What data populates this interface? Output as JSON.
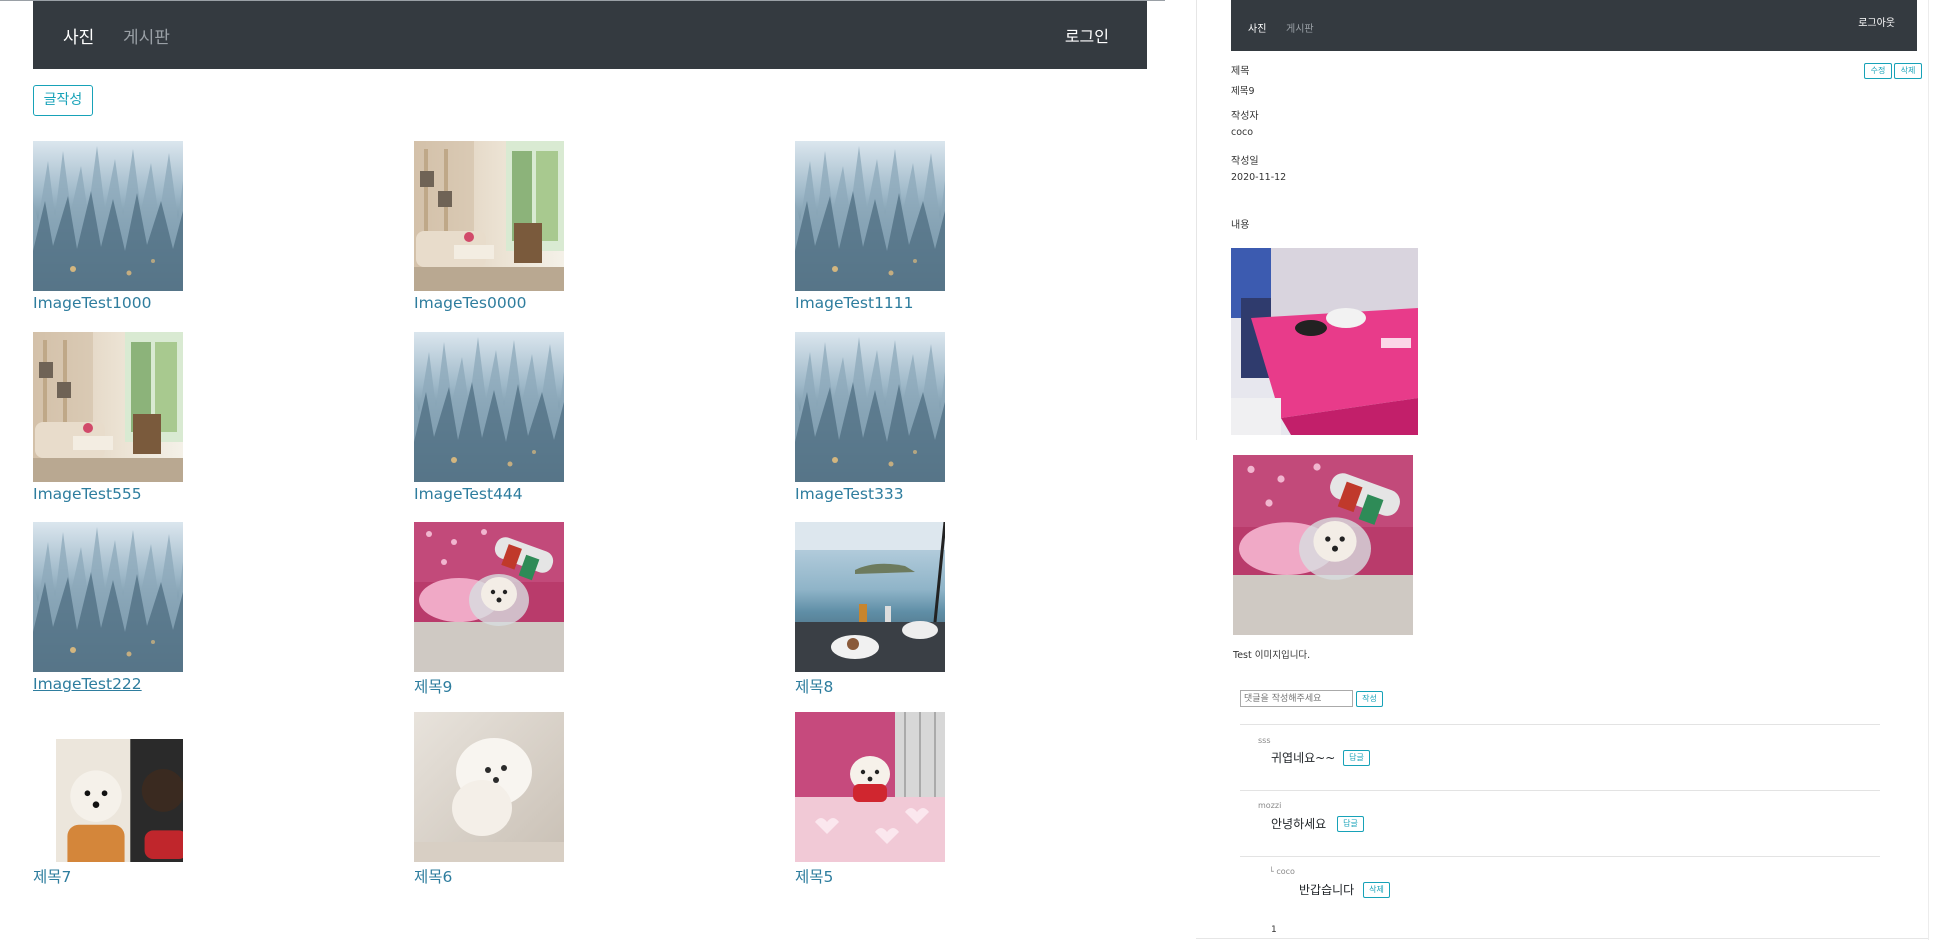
{
  "left": {
    "navbar": {
      "photo": "사진",
      "board": "게시판",
      "login": "로그인"
    },
    "write_button": "글작성",
    "cards": [
      {
        "caption": "ImageTest1000",
        "image": "frost-crystals"
      },
      {
        "caption": "ImageTes0000",
        "image": "living-room"
      },
      {
        "caption": "ImageTest1111",
        "image": "frost-crystals"
      },
      {
        "caption": "ImageTest555",
        "image": "living-room"
      },
      {
        "caption": "ImageTest444",
        "image": "frost-crystals"
      },
      {
        "caption": "ImageTest333",
        "image": "frost-crystals"
      },
      {
        "caption": "ImageTest222",
        "image": "frost-crystals"
      },
      {
        "caption": "제목9",
        "image": "dog-pink-pillow"
      },
      {
        "caption": "제목8",
        "image": "sea-view-breakfast"
      },
      {
        "caption": "제목7",
        "image": "two-dogs"
      },
      {
        "caption": "제목6",
        "image": "white-puppy"
      },
      {
        "caption": "제목5",
        "image": "puppy-on-mat"
      }
    ]
  },
  "right": {
    "navbar": {
      "photo": "사진",
      "board": "게시판",
      "logout": "로그아웃"
    },
    "edit_button": "수정",
    "delete_button": "삭제",
    "fields": {
      "title_label": "제목",
      "title_value": "제목9",
      "author_label": "작성자",
      "author_value": "coco",
      "date_label": "작성일",
      "date_value": "2020-11-12",
      "content_label": "내용"
    },
    "images": [
      "dogs-on-pink-mattress",
      "dog-pink-pillow"
    ],
    "body_text": "Test 이미지입니다.",
    "comment_form": {
      "placeholder": "댓글을 작성해주세요",
      "submit": "작성"
    },
    "comments": [
      {
        "author": "sss",
        "text": "귀엽네요~~",
        "button": "답글"
      },
      {
        "author": "mozzi",
        "text": "안녕하세요",
        "button": "답글"
      },
      {
        "author": "└ coco",
        "text": "반갑습니다",
        "button": "삭제"
      }
    ],
    "pagination": "1"
  }
}
